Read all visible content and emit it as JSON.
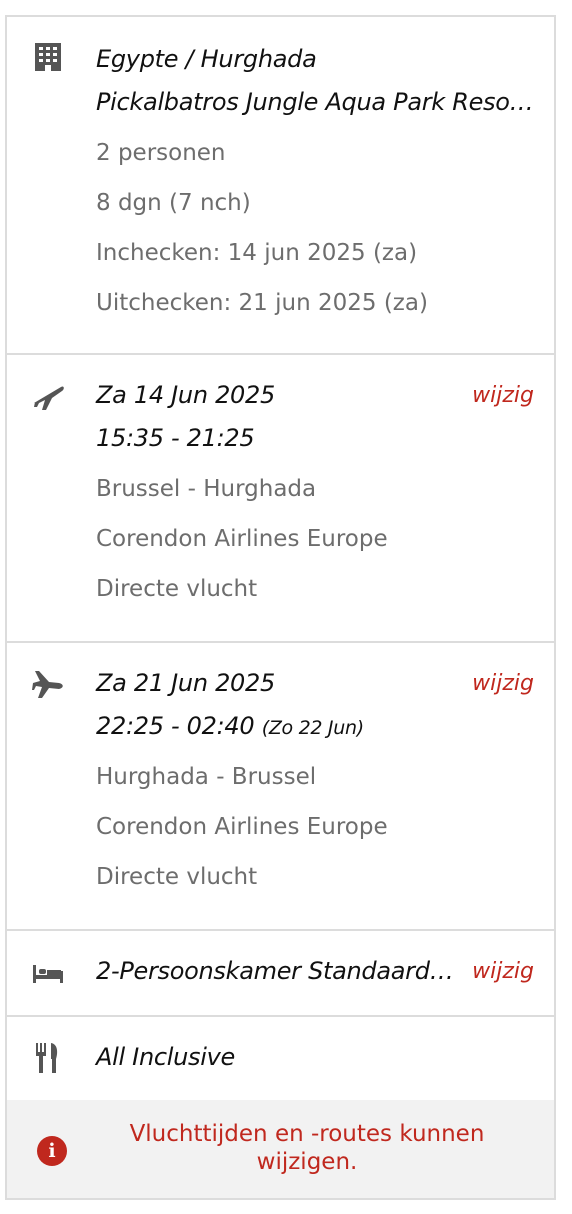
{
  "hotel": {
    "destination": "Egypte / Hurghada",
    "name": "Pickalbatros Jungle Aqua Park Reso…",
    "persons": "2 personen",
    "duration": "8 dgn (7 nch)",
    "checkin": "Inchecken: 14 jun 2025 (za)",
    "checkout": "Uitchecken: 21 jun 2025 (za)"
  },
  "outbound": {
    "date": "Za 14 Jun 2025",
    "time": "15:35 - 21:25",
    "route": "Brussel - Hurghada",
    "airline": "Corendon Airlines Europe",
    "type": "Directe vlucht",
    "change": "wijzig"
  },
  "return": {
    "date": "Za 21 Jun 2025",
    "time": "22:25 - 02:40",
    "arrival_note": "(Zo 22 Jun)",
    "route": "Hurghada - Brussel",
    "airline": "Corendon Airlines Europe",
    "type": "Directe vlucht",
    "change": "wijzig"
  },
  "room": {
    "label": "2-Persoonskamer Standaard (…",
    "change": "wijzig"
  },
  "board": {
    "label": "All Inclusive"
  },
  "notice": {
    "text": "Vluchttijden en -routes kunnen wijzigen."
  },
  "colors": {
    "accent": "#c0281e",
    "text_muted": "#6d6d6d",
    "icon": "#555555",
    "notice_bg": "#f2f2f2"
  },
  "icons": [
    "building-icon",
    "plane-departure-icon",
    "plane-arrival-icon",
    "bed-icon",
    "cutlery-icon",
    "info-icon"
  ]
}
